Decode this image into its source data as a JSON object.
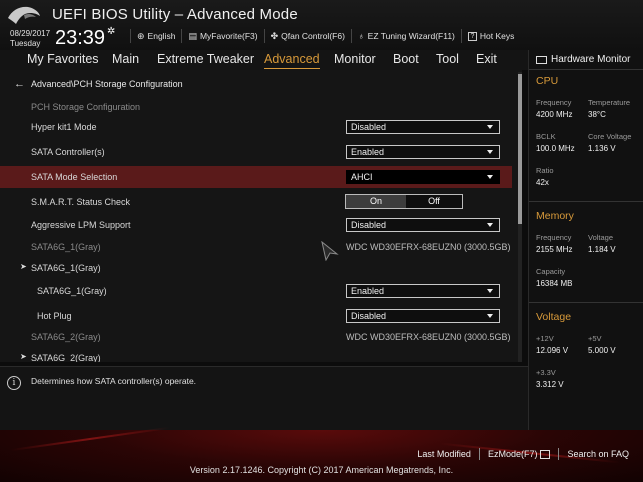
{
  "header": {
    "title": "UEFI BIOS Utility – Advanced Mode",
    "date": "08/29/2017",
    "day": "Tuesday",
    "time": "23:39",
    "links": [
      {
        "label": "English",
        "icon": "globe-icon"
      },
      {
        "label": "MyFavorite(F3)",
        "icon": "favorite-icon"
      },
      {
        "label": "Qfan Control(F6)",
        "icon": "fan-icon"
      },
      {
        "label": "EZ Tuning Wizard(F11)",
        "icon": "bulb-icon"
      },
      {
        "label": "Hot Keys",
        "icon": "question-icon"
      }
    ]
  },
  "menu": {
    "tabs": [
      "My Favorites",
      "Main",
      "Extreme Tweaker",
      "Advanced",
      "Monitor",
      "Boot",
      "Tool",
      "Exit"
    ],
    "active": "Advanced"
  },
  "main": {
    "breadcrumb": "Advanced\\PCH Storage Configuration",
    "section_title": "PCH Storage Configuration",
    "rows": [
      {
        "label": "Hyper kit1 Mode",
        "value": "Disabled"
      },
      {
        "label": "SATA Controller(s)",
        "value": "Enabled"
      },
      {
        "label": "SATA Mode Selection",
        "value": "AHCI"
      },
      {
        "label": "S.M.A.R.T. Status Check",
        "on": "On",
        "off": "Off"
      },
      {
        "label": "Aggressive LPM Support",
        "value": "Disabled"
      },
      {
        "label": "SATA6G_1(Gray)",
        "value": "WDC WD30EFRX-68EUZN0 (3000.5GB)"
      },
      {
        "label": "SATA6G_1(Gray)"
      },
      {
        "label": "SATA6G_1(Gray)",
        "value": "Enabled"
      },
      {
        "label": "Hot Plug",
        "value": "Disabled"
      },
      {
        "label": "SATA6G_2(Gray)",
        "value": "WDC WD30EFRX-68EUZN0 (3000.5GB)"
      },
      {
        "label": "SATA6G_2(Gray)"
      }
    ]
  },
  "help": {
    "text": "Determines how SATA controller(s) operate."
  },
  "hardware_monitor": {
    "title": "Hardware Monitor",
    "cpu": {
      "heading": "CPU",
      "frequency_label": "Frequency",
      "frequency": "4200 MHz",
      "temperature_label": "Temperature",
      "temperature": "38°C",
      "bclk_label": "BCLK",
      "bclk": "100.0 MHz",
      "core_voltage_label": "Core Voltage",
      "core_voltage": "1.136 V",
      "ratio_label": "Ratio",
      "ratio": "42x"
    },
    "memory": {
      "heading": "Memory",
      "frequency_label": "Frequency",
      "frequency": "2155 MHz",
      "voltage_label": "Voltage",
      "voltage": "1.184 V",
      "capacity_label": "Capacity",
      "capacity": "16384 MB"
    },
    "voltage": {
      "heading": "Voltage",
      "v12_label": "+12V",
      "v12": "12.096 V",
      "v5_label": "+5V",
      "v5": "5.000 V",
      "v33_label": "+3.3V",
      "v33": "3.312 V"
    }
  },
  "footer": {
    "last_modified": "Last Modified",
    "ezmode": "EzMode(F7)",
    "search": "Search on FAQ",
    "copyright": "Version 2.17.1246. Copyright (C) 2017 American Megatrends, Inc."
  },
  "colors": {
    "accent": "#d89a3a",
    "highlight_row": "#5a1a1a",
    "background": "#151515"
  }
}
